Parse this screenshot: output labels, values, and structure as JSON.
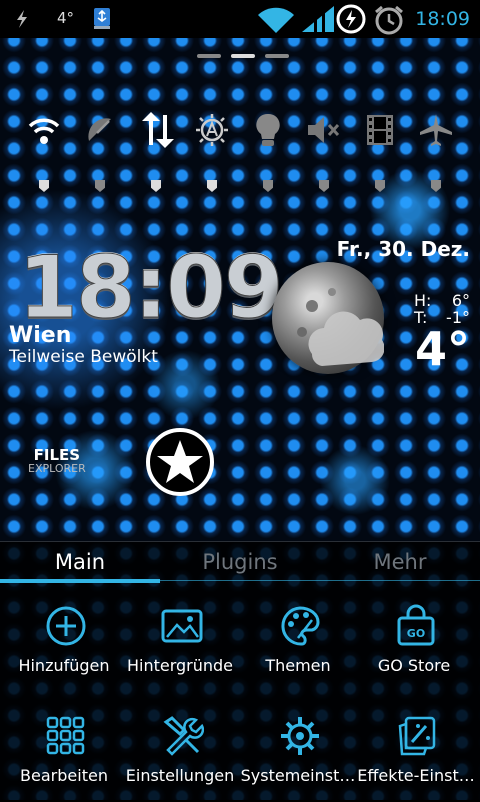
{
  "status_bar": {
    "temperature": "4°",
    "time": "18:09",
    "icons": [
      "charging-bolt-icon",
      "usb-icon",
      "wifi-icon",
      "signal-icon",
      "data-sync-icon",
      "alarm-clock-icon"
    ]
  },
  "home_pager": {
    "pages": 3,
    "current_page": 2
  },
  "quick_toggles": [
    {
      "name": "wifi",
      "icon": "wifi-icon",
      "on": true
    },
    {
      "name": "gps",
      "icon": "satellite-dish-icon",
      "on": false
    },
    {
      "name": "mobile-data",
      "icon": "data-arrows-icon",
      "on": true
    },
    {
      "name": "auto-brightness",
      "icon": "brightness-auto-icon",
      "on": true
    },
    {
      "name": "flashlight",
      "icon": "lightbulb-icon",
      "on": false
    },
    {
      "name": "sound",
      "icon": "mute-icon",
      "on": false
    },
    {
      "name": "video",
      "icon": "film-icon",
      "on": false
    },
    {
      "name": "airplane",
      "icon": "airplane-icon",
      "on": false
    }
  ],
  "clock_widget": {
    "time": "18:09",
    "city": "Wien",
    "condition": "Teilweise Bewölkt",
    "date": "Fr., 30. Dez.",
    "high_label": "H:",
    "high_value": "6°",
    "low_label": "T:",
    "low_value": "-1°",
    "current_temp": "4°"
  },
  "files_explorer": {
    "title": "FILES",
    "subtitle": "EXPLORER"
  },
  "menu": {
    "tabs": [
      {
        "label": "Main",
        "active": true
      },
      {
        "label": "Plugins",
        "active": false
      },
      {
        "label": "Mehr",
        "active": false
      }
    ],
    "items": [
      {
        "label": "Hinzufügen",
        "icon": "add-icon"
      },
      {
        "label": "Hintergründe",
        "icon": "wallpaper-icon"
      },
      {
        "label": "Themen",
        "icon": "palette-icon"
      },
      {
        "label": "GO Store",
        "icon": "store-bag-icon"
      },
      {
        "label": "Bearbeiten",
        "icon": "grid-edit-icon"
      },
      {
        "label": "Einstellungen",
        "icon": "tools-icon"
      },
      {
        "label": "Systemeinst…",
        "icon": "settings-gear-icon"
      },
      {
        "label": "Effekte-Einst…",
        "icon": "effects-icon"
      }
    ]
  },
  "colors": {
    "accent": "#33b5e5",
    "inactive_tab": "#6f767d",
    "dot_blue": "#1f8df0"
  }
}
